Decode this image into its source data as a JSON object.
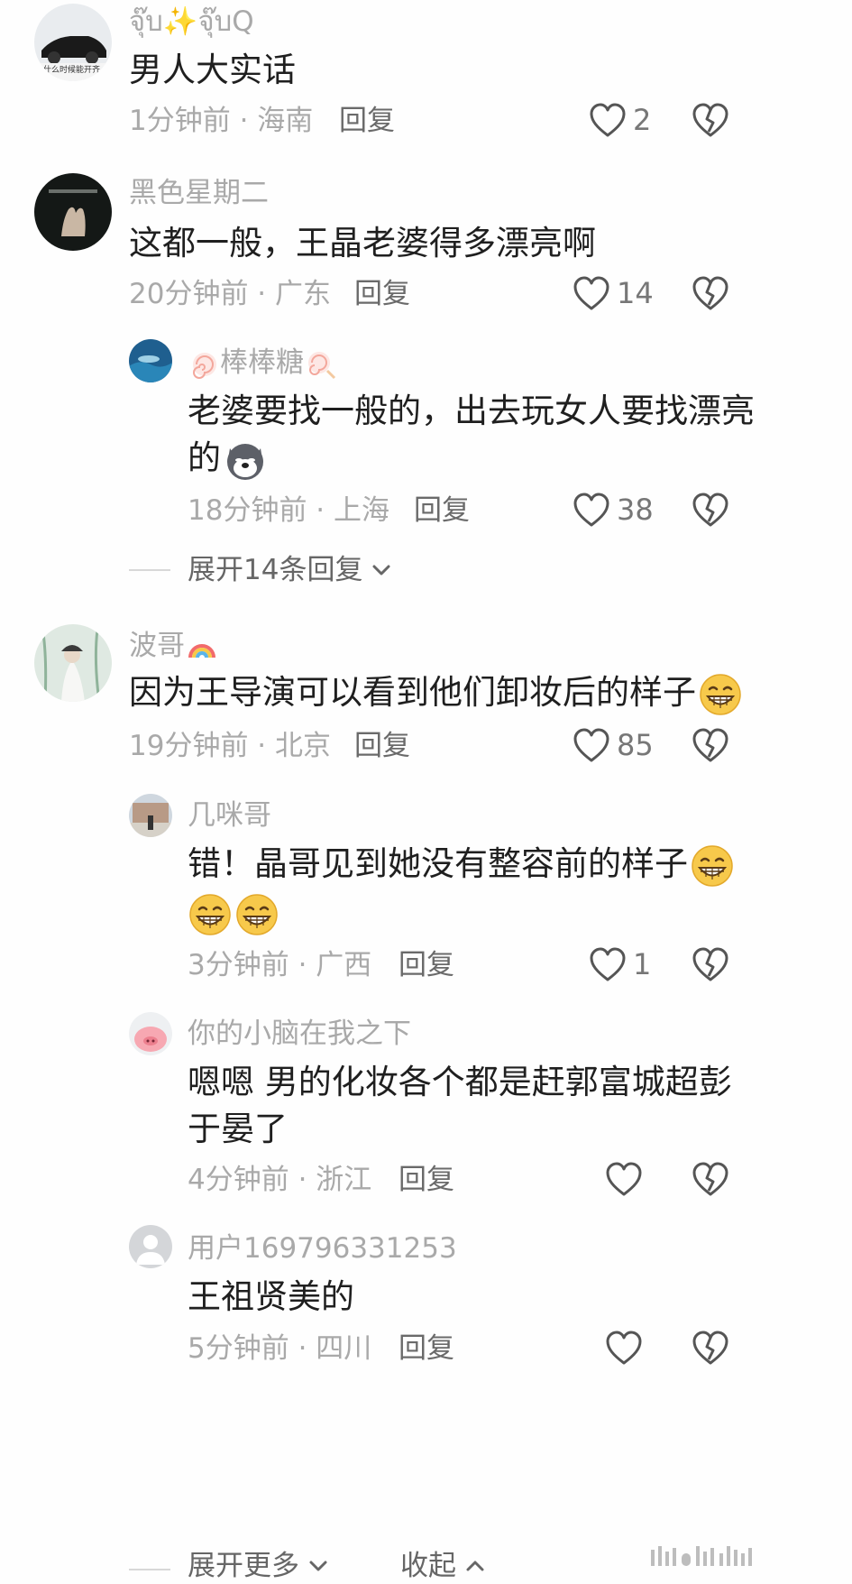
{
  "comments": [
    {
      "username": "จุ๊บ✨จุ๊บQ",
      "text": "男人大实话",
      "time": "1分钟前",
      "location": "海南",
      "reply_label": "回复",
      "likes": "2"
    },
    {
      "username": "黑色星期二",
      "text": "这都一般，王晶老婆得多漂亮啊",
      "time": "20分钟前",
      "location": "广东",
      "reply_label": "回复",
      "likes": "14",
      "replies": [
        {
          "username": "棒棒糖",
          "text_line1": "老婆要找一般的，出去玩女人要找漂亮",
          "text_line2": "的",
          "time": "18分钟前",
          "location": "上海",
          "reply_label": "回复",
          "likes": "38"
        }
      ],
      "expand_label": "展开14条回复"
    },
    {
      "username": "波哥",
      "text": "因为王导演可以看到他们卸妆后的样子",
      "time": "19分钟前",
      "location": "北京",
      "reply_label": "回复",
      "likes": "85",
      "replies": [
        {
          "username": "几咪哥",
          "text_line1": "错！晶哥见到她没有整容前的样子",
          "time": "3分钟前",
          "location": "广西",
          "reply_label": "回复",
          "likes": "1"
        },
        {
          "username": "你的小脑在我之下",
          "text_line1": "嗯嗯 男的化妆各个都是赶郭富城超彭",
          "text_line2": "于晏了",
          "time": "4分钟前",
          "location": "浙江",
          "reply_label": "回复",
          "likes": ""
        },
        {
          "username": "用户169796331253",
          "text_line1": "王祖贤美的",
          "time": "5分钟前",
          "location": "四川",
          "reply_label": "回复",
          "likes": ""
        }
      ]
    }
  ],
  "footer": {
    "expand_more_label": "展开更多",
    "collapse_label": "收起"
  },
  "meta_separator": " · ",
  "avatar1_caption": "什么时候能开齐",
  "colors": {
    "muted": "#a9a9a9",
    "text": "#1f1f1f",
    "reply": "#6a6a6a"
  }
}
